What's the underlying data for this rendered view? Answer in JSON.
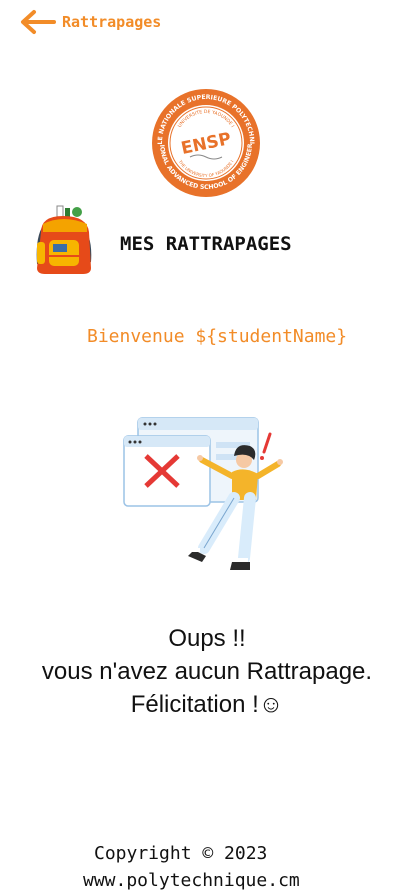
{
  "header": {
    "back_icon": "arrow-left-icon",
    "title": "Rattrapages",
    "accent_color": "#f28c28"
  },
  "logo": {
    "ring_text_top": "ECOLE NATIONALE SUPERIEURE POLYTECHNIQUE",
    "ring_text_bottom": "NATIONAL ADVANCED SCHOOL OF ENGINEERING",
    "inner_top": "UNIVERSITE DE YAOUNDE I",
    "inner_bottom": "THE UNIVERSITY OF YAOUNDE I",
    "acronym": "ENSP"
  },
  "section": {
    "icon": "backpack-icon",
    "title": "MES RATTRAPAGES"
  },
  "welcome": "Bienvenue ${studentName}",
  "empty_state": {
    "illustration": "error-window-illustration",
    "line1": "Oups !!",
    "line2": "vous n'avez aucun Rattrapage.",
    "line3": "Félicitation !☺"
  },
  "footer": {
    "copyright": "Copyright © 2023",
    "website": "www.polytechnique.cm"
  }
}
